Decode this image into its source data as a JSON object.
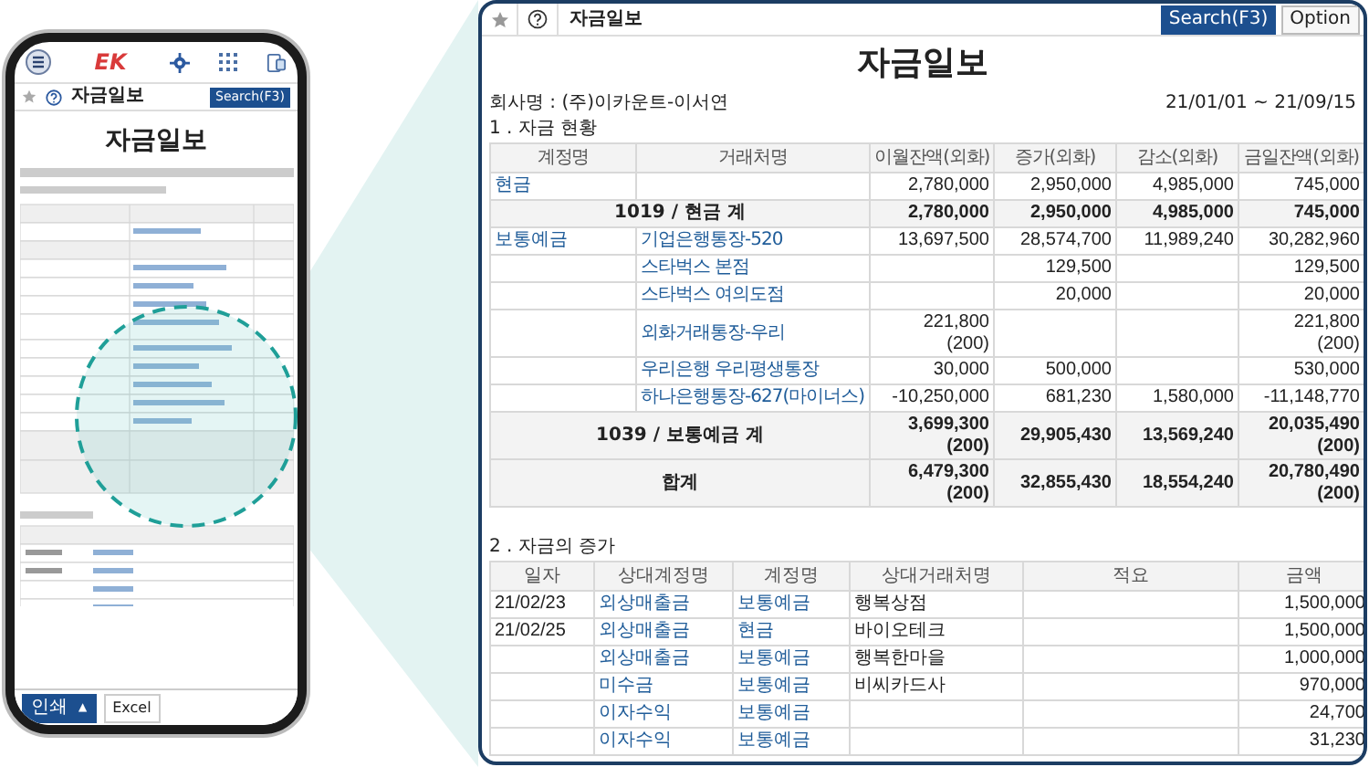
{
  "phone": {
    "logo": "EK",
    "toolbar_title": "자금일보",
    "search_button": "Search(F3)",
    "title": "자금일보",
    "print_button": "인쇄",
    "print_caret": "▲",
    "excel_button": "Excel"
  },
  "panel": {
    "toolbar_title": "자금일보",
    "search_button": "Search(F3)",
    "option_button": "Option",
    "title": "자금일보",
    "company": "회사명 : (주)이카운트-이서연",
    "period": "21/01/01 ~ 21/09/15",
    "section_1": "1 . 자금 현황",
    "table_1": {
      "columns": [
        "계정명",
        "거래처명",
        "이월잔액(외화)",
        "증가(외화)",
        "감소(외화)",
        "금일잔액(외화)"
      ],
      "rows": [
        {
          "kind": "item",
          "account": "현금",
          "values": [
            "2,780,000",
            "2,950,000",
            "4,985,000",
            "745,000"
          ]
        },
        {
          "kind": "subtotal",
          "label": "1019 / 현금 계",
          "values": [
            "2,780,000",
            "2,950,000",
            "4,985,000",
            "745,000"
          ]
        },
        {
          "kind": "item",
          "account": "보통예금",
          "partner": "기업은행통장-520",
          "values": [
            "13,697,500",
            "28,574,700",
            "11,989,240",
            "30,282,960"
          ]
        },
        {
          "kind": "item",
          "partner": "스타벅스 본점",
          "values": {
            "1": "129,500",
            "3": "129,500"
          }
        },
        {
          "kind": "item",
          "partner": "스타벅스 여의도점",
          "values": {
            "1": "20,000",
            "3": "20,000"
          }
        },
        {
          "kind": "item",
          "partner": "외화거래통장-우리",
          "values": {
            "0": "221,800\n(200)",
            "3": "221,800\n(200)"
          }
        },
        {
          "kind": "item",
          "partner": "우리은행 우리평생통장",
          "values": {
            "0": "30,000",
            "1": "500,000",
            "3": "530,000"
          }
        },
        {
          "kind": "item",
          "partner": "하나은행통장-627(마이너스)",
          "values": [
            "-10,250,000",
            "681,230",
            "1,580,000",
            "-11,148,770"
          ]
        },
        {
          "kind": "subtotal",
          "label": "1039 / 보통예금 계",
          "values": [
            "3,699,300\n(200)",
            "29,905,430",
            "13,569,240",
            "20,035,490\n(200)"
          ]
        },
        {
          "kind": "subtotal",
          "label": "합계",
          "values": [
            "6,479,300\n(200)",
            "32,855,430",
            "18,554,240",
            "20,780,490\n(200)"
          ]
        }
      ]
    },
    "section_2": "2 . 자금의 증가",
    "table_2": {
      "columns": [
        "일자",
        "상대계정명",
        "계정명",
        "상대거래처명",
        "적요",
        "금액"
      ],
      "rows": [
        {
          "date": "21/02/23",
          "counter_account": "외상매출금",
          "account": "보통예금",
          "partner": "행복상점",
          "amount": "1,500,000"
        },
        {
          "date": "21/02/25",
          "counter_account": "외상매출금",
          "account": "현금",
          "partner": "바이오테크",
          "amount": "1,500,000"
        },
        {
          "counter_account": "외상매출금",
          "account": "보통예금",
          "partner": "행복한마을",
          "amount": "1,000,000"
        },
        {
          "counter_account": "미수금",
          "account": "보통예금",
          "partner": "비씨카드사",
          "amount": "970,000"
        },
        {
          "counter_account": "이자수익",
          "account": "보통예금",
          "amount": "24,700"
        },
        {
          "counter_account": "이자수익",
          "account": "보통예금",
          "amount": "31,230"
        }
      ]
    }
  }
}
